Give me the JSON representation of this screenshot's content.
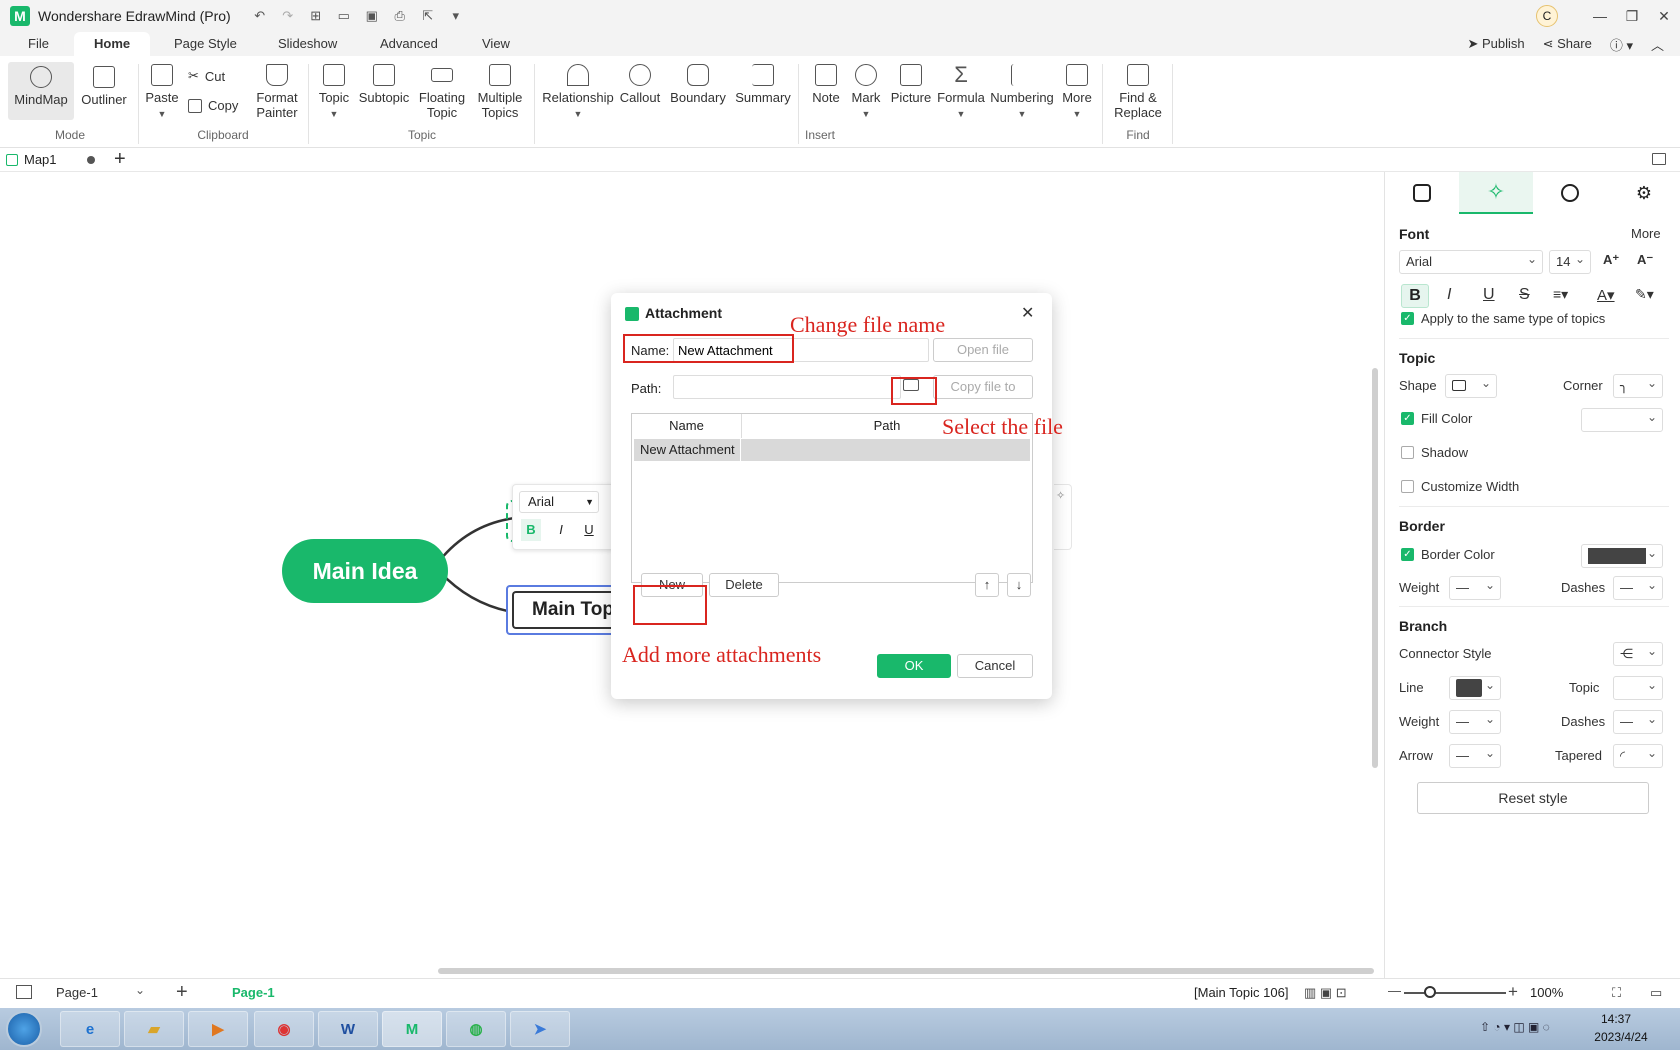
{
  "app": {
    "title": "Wondershare EdrawMind (Pro)",
    "avatar": "C"
  },
  "menu": {
    "tabs": [
      "File",
      "Home",
      "Page Style",
      "Slideshow",
      "Advanced",
      "View"
    ],
    "active": "Home",
    "publish": "Publish",
    "share": "Share"
  },
  "ribbon": {
    "mindmap": "MindMap",
    "outliner": "Outliner",
    "mode_group": "Mode",
    "paste": "Paste",
    "cut": "Cut",
    "copy": "Copy",
    "format_painter_1": "Format",
    "format_painter_2": "Painter",
    "clipboard_group": "Clipboard",
    "topic": "Topic",
    "subtopic": "Subtopic",
    "floating_1": "Floating",
    "floating_2": "Topic",
    "multiple_1": "Multiple",
    "multiple_2": "Topics",
    "topic_group": "Topic",
    "relationship": "Relationship",
    "callout": "Callout",
    "boundary": "Boundary",
    "summary": "Summary",
    "note": "Note",
    "mark": "Mark",
    "picture": "Picture",
    "formula": "Formula",
    "numbering": "Numbering",
    "more": "More",
    "insert_group": "Insert",
    "find_1": "Find &",
    "find_2": "Replace",
    "find_group": "Find"
  },
  "doc_tab": {
    "name": "Map1"
  },
  "canvas": {
    "main_idea": "Main Idea",
    "main_topic": "Main Top",
    "mini_font": "Arial",
    "mini_bold": "B",
    "mini_italic": "I",
    "mini_underline": "U"
  },
  "dialog": {
    "title": "Attachment",
    "name_label": "Name:",
    "name_value": "New Attachment",
    "open_file": "Open file",
    "path_label": "Path:",
    "path_value": "",
    "copy_file_to": "Copy file to",
    "col_name": "Name",
    "col_path": "Path",
    "rows": [
      {
        "name": "New Attachment",
        "path": ""
      }
    ],
    "new": "New",
    "delete": "Delete",
    "ok": "OK",
    "cancel": "Cancel"
  },
  "annotations": {
    "change_name": "Change file name",
    "select_file": "Select the file",
    "add_more": "Add more attachments"
  },
  "panel": {
    "font_header": "Font",
    "more": "More",
    "font_family": "Arial",
    "font_size": "14",
    "apply_same": "Apply to the same type of topics",
    "topic_header": "Topic",
    "shape": "Shape",
    "corner": "Corner",
    "fill_color": "Fill Color",
    "shadow": "Shadow",
    "customize_width": "Customize Width",
    "border_header": "Border",
    "border_color": "Border Color",
    "weight": "Weight",
    "dashes": "Dashes",
    "branch_header": "Branch",
    "connector_style": "Connector Style",
    "line": "Line",
    "topic": "Topic",
    "branch_weight": "Weight",
    "branch_dashes": "Dashes",
    "arrow": "Arrow",
    "tapered": "Tapered",
    "reset_style": "Reset style"
  },
  "status": {
    "page_select": "Page-1",
    "page_tab": "Page-1",
    "selection": "[Main Topic 106]",
    "zoom": "100%"
  },
  "taskbar": {
    "time": "14:37",
    "date": "2023/4/24"
  },
  "colors": {
    "accent": "#19b86b",
    "annotation": "#d9251f",
    "focus_blue": "#5a7be0"
  }
}
